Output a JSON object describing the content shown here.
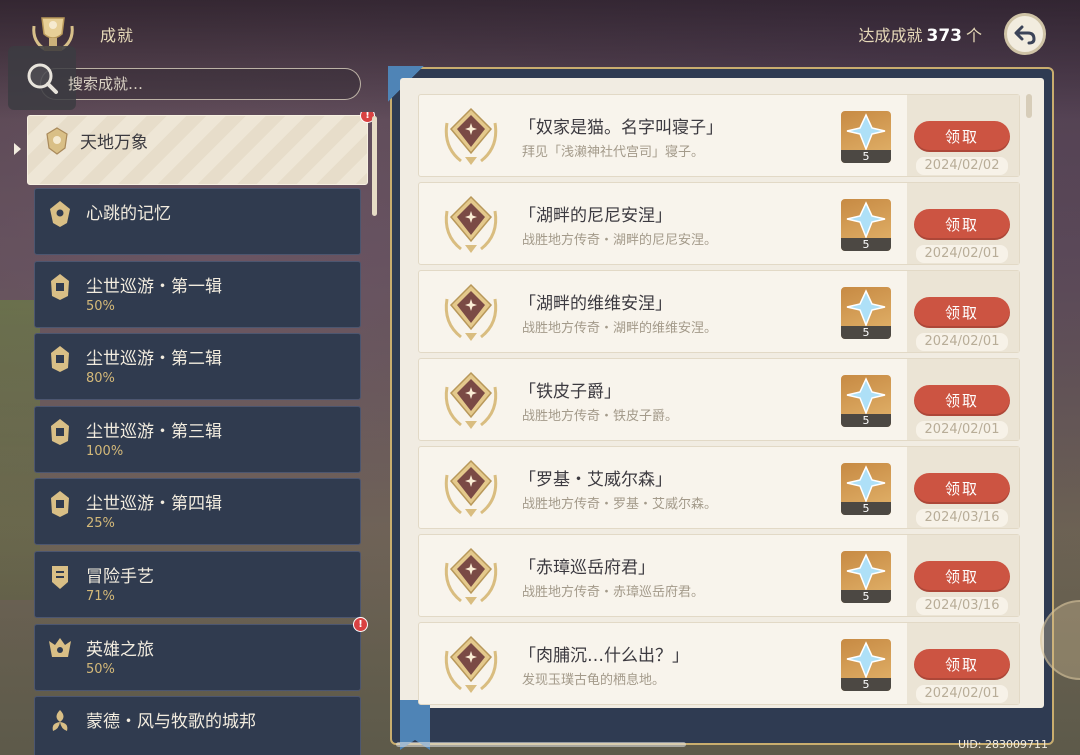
{
  "header": {
    "title": "成就",
    "total_prefix": "达成成就",
    "total_count": "373",
    "total_suffix": "个"
  },
  "search": {
    "placeholder": "搜索成就…"
  },
  "categories": [
    {
      "name": "天地万象",
      "percent": "",
      "active": true,
      "badge": "!"
    },
    {
      "name": "心跳的记忆",
      "percent": "",
      "active": false,
      "badge": ""
    },
    {
      "name": "尘世巡游・第一辑",
      "percent": "50%",
      "active": false,
      "badge": ""
    },
    {
      "name": "尘世巡游・第二辑",
      "percent": "80%",
      "active": false,
      "badge": ""
    },
    {
      "name": "尘世巡游・第三辑",
      "percent": "100%",
      "active": false,
      "badge": ""
    },
    {
      "name": "尘世巡游・第四辑",
      "percent": "25%",
      "active": false,
      "badge": ""
    },
    {
      "name": "冒险手艺",
      "percent": "71%",
      "active": false,
      "badge": ""
    },
    {
      "name": "英雄之旅",
      "percent": "50%",
      "active": false,
      "badge": "!"
    },
    {
      "name": "蒙德・风与牧歌的城邦",
      "percent": "",
      "active": false,
      "badge": ""
    }
  ],
  "achievements": [
    {
      "title": "「奴家是猫。名字叫寝子」",
      "desc": "拜见「浅濑神社代宫司」寝子。",
      "reward_count": "5",
      "button": "领取",
      "date": "2024/02/02"
    },
    {
      "title": "「湖畔的尼尼安涅」",
      "desc": "战胜地方传奇・湖畔的尼尼安涅。",
      "reward_count": "5",
      "button": "领取",
      "date": "2024/02/01"
    },
    {
      "title": "「湖畔的维维安涅」",
      "desc": "战胜地方传奇・湖畔的维维安涅。",
      "reward_count": "5",
      "button": "领取",
      "date": "2024/02/01"
    },
    {
      "title": "「铁皮子爵」",
      "desc": "战胜地方传奇・铁皮子爵。",
      "reward_count": "5",
      "button": "领取",
      "date": "2024/02/01"
    },
    {
      "title": "「罗基・艾威尔森」",
      "desc": "战胜地方传奇・罗基・艾威尔森。",
      "reward_count": "5",
      "button": "领取",
      "date": "2024/03/16"
    },
    {
      "title": "「赤璋巡岳府君」",
      "desc": "战胜地方传奇・赤璋巡岳府君。",
      "reward_count": "5",
      "button": "领取",
      "date": "2024/03/16"
    },
    {
      "title": "「肉脯沉…什么出？」",
      "desc": "发现玉璞古龟的栖息地。",
      "reward_count": "5",
      "button": "领取",
      "date": "2024/02/01"
    }
  ],
  "footer": {
    "uid": "UID: 283009711"
  },
  "colors": {
    "claim_button": "#cc5442",
    "category_bg": "#303b4f",
    "active_category_bg": "#eee6d6",
    "percent_gold": "#d4b979",
    "badge_red": "#d94242"
  },
  "icons": {
    "header": "trophy-emblem-icon",
    "search": "magnifier-icon",
    "back": "back-arrow-icon",
    "reward": "primogem-icon",
    "achievement": "achievement-medal-icon"
  }
}
